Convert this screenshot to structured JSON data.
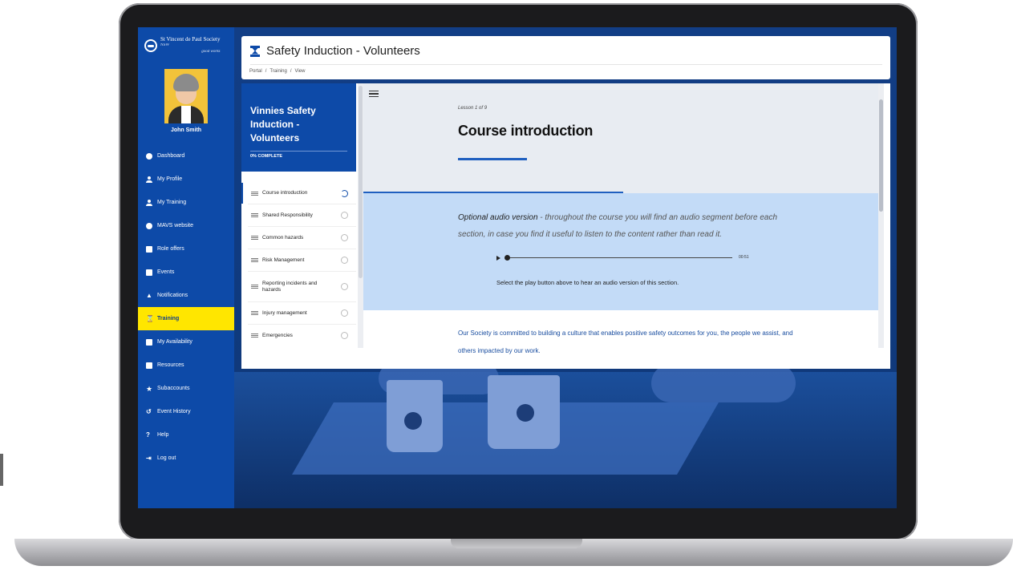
{
  "brand": {
    "name": "St Vincent de Paul Society",
    "sub": "NSW",
    "tagline": "good works"
  },
  "user": {
    "name": "John Smith"
  },
  "sidebar": {
    "items": [
      {
        "label": "Dashboard",
        "icon": "dashboard-icon"
      },
      {
        "label": "My Profile",
        "icon": "user-icon"
      },
      {
        "label": "My Training",
        "icon": "training-icon"
      },
      {
        "label": "MAVS website",
        "icon": "globe-icon"
      },
      {
        "label": "Role offers",
        "icon": "briefcase-icon"
      },
      {
        "label": "Events",
        "icon": "calendar-icon"
      },
      {
        "label": "Notifications",
        "icon": "bell-icon"
      },
      {
        "label": "Training",
        "icon": "hourglass-icon",
        "active": true
      },
      {
        "label": "My Availability",
        "icon": "calendar-check-icon"
      },
      {
        "label": "Resources",
        "icon": "folder-icon"
      },
      {
        "label": "Subaccounts",
        "icon": "star-icon"
      },
      {
        "label": "Event History",
        "icon": "history-icon"
      },
      {
        "label": "Help",
        "icon": "question-icon"
      },
      {
        "label": "Log out",
        "icon": "logout-icon"
      }
    ]
  },
  "header": {
    "title": "Safety Induction - Volunteers"
  },
  "breadcrumb": [
    "Portal",
    "/",
    "Training",
    "/",
    "View"
  ],
  "course": {
    "title": "Vinnies Safety Induction - Volunteers",
    "progress": "0% COMPLETE",
    "lessons": [
      {
        "label": "Course introduction",
        "current": true
      },
      {
        "label": "Shared Responsibility"
      },
      {
        "label": "Common hazards"
      },
      {
        "label": "Risk Management"
      },
      {
        "label": "Reporting incidents and hazards"
      },
      {
        "label": "Injury management"
      },
      {
        "label": "Emergencies"
      }
    ]
  },
  "lesson": {
    "count": "Lesson 1 of 9",
    "title": "Course introduction",
    "audio_label": "Optional audio version",
    "audio_text": " - throughout the course you will find an audio segment before each section, in case you find it useful to listen to the content rather than read it.",
    "audio_time": "00:51",
    "audio_hint": "Select the play button above to hear an audio version of this section.",
    "body": "Our Society is committed to building a culture that enables positive safety outcomes for you, the people we assist, and others impacted by our work."
  },
  "colors": {
    "brand_blue": "#0d4aa8",
    "active_yellow": "#ffe600",
    "audio_bg": "#c3dbf7"
  }
}
